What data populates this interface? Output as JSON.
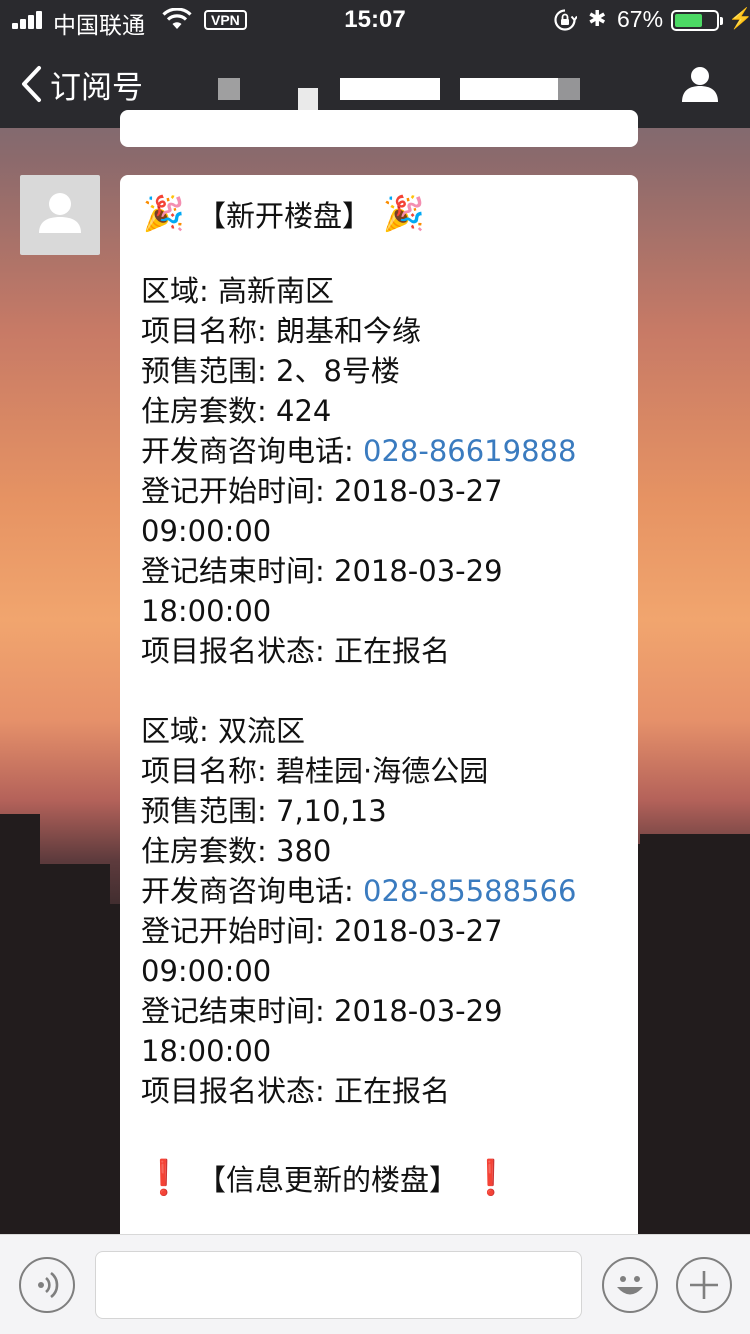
{
  "status_bar": {
    "carrier": "中国联通",
    "vpn": "VPN",
    "time": "15:07",
    "battery_percent": "67%",
    "battery_level": 0.67,
    "icons": [
      "signal-icon",
      "wifi-icon",
      "rotation-lock-icon",
      "bluetooth-icon",
      "battery-icon",
      "charging-bolt-icon"
    ]
  },
  "nav": {
    "back_label": "订阅号",
    "back_icon": "chevron-left-icon",
    "profile_icon": "person-icon"
  },
  "message": {
    "header": {
      "emoji": "🎉",
      "text": "【新开楼盘】"
    },
    "projects": [
      {
        "area": "区域: 高新南区",
        "name": "项目名称: 朗基和今缘",
        "presale": "预售范围: 2、8号楼",
        "units": "住房套数: 424",
        "phone_label": "开发商咨询电话: ",
        "phone": "028-86619888",
        "reg_start_label": "登记开始时间: 2018-03-27",
        "reg_start_time": "09:00:00",
        "reg_end_label": "登记结束时间: 2018-03-29",
        "reg_end_time": "18:00:00",
        "status": "项目报名状态: 正在报名"
      },
      {
        "area": "区域: 双流区",
        "name": "项目名称: 碧桂园·海德公园",
        "presale": "预售范围: 7,10,13",
        "units": "住房套数: 380",
        "phone_label": "开发商咨询电话: ",
        "phone": "028-85588566",
        "reg_start_label": "登记开始时间: 2018-03-27",
        "reg_start_time": "09:00:00",
        "reg_end_label": "登记结束时间: 2018-03-29",
        "reg_end_time": "18:00:00",
        "status": "项目报名状态: 正在报名"
      }
    ],
    "footer": {
      "mark": "❗",
      "text": "【信息更新的楼盘】"
    }
  },
  "input_bar": {
    "value": "",
    "icons": [
      "voice-icon",
      "emoji-icon",
      "plus-icon"
    ]
  },
  "colors": {
    "nav_bg": "#2a2a2e",
    "link": "#3a7bbf",
    "battery": "#4cd964",
    "exclaim": "#d6202a"
  }
}
